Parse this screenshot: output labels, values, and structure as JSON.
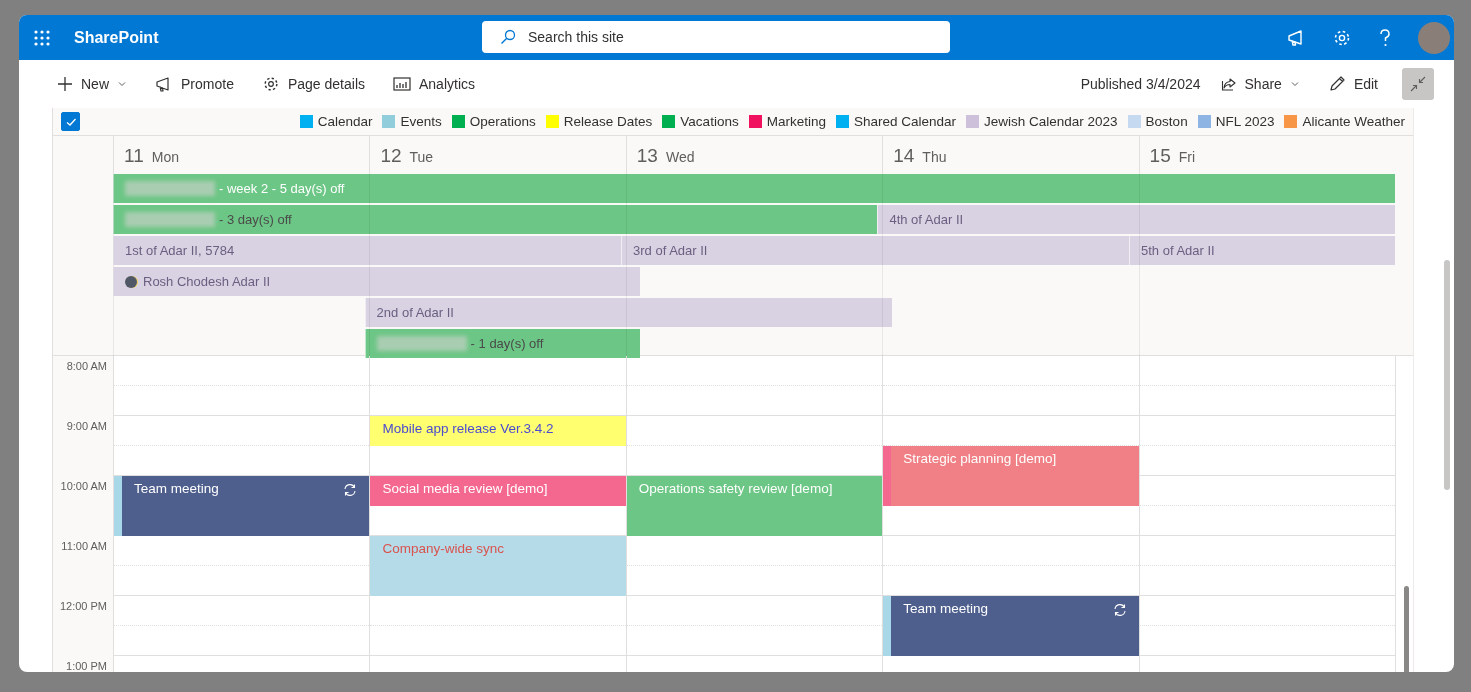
{
  "app_bar": {
    "title": "SharePoint",
    "search": {
      "placeholder": "Search this site"
    }
  },
  "command_bar": {
    "left": [
      {
        "kind": "new",
        "label": "New"
      },
      {
        "kind": "promote",
        "label": "Promote"
      },
      {
        "kind": "details",
        "label": "Page details"
      },
      {
        "kind": "analytics",
        "label": "Analytics"
      }
    ],
    "published": "Published 3/4/2024",
    "share": "Share",
    "edit": "Edit"
  },
  "legend": {
    "all_checked": true,
    "items": [
      {
        "label": "Calendar",
        "color": "#00b0f0"
      },
      {
        "label": "Events",
        "color": "#92cddc"
      },
      {
        "label": "Operations",
        "color": "#00b050"
      },
      {
        "label": "Release Dates",
        "color": "#ffff00"
      },
      {
        "label": "Vacations",
        "color": "#00b050"
      },
      {
        "label": "Marketing",
        "color": "#f0115f"
      },
      {
        "label": "Shared Calendar",
        "color": "#00b0f0"
      },
      {
        "label": "Jewish Calendar 2023",
        "color": "#ccc0da"
      },
      {
        "label": "Boston",
        "color": "#c5d9f1"
      },
      {
        "label": "NFL 2023",
        "color": "#8db4e2"
      },
      {
        "label": "Alicante Weather",
        "color": "#f79646"
      }
    ]
  },
  "days": [
    {
      "date": "11",
      "weekday": "Mon",
      "slots": [
        {
          "kind": "free"
        },
        {
          "kind": "free"
        },
        {
          "kind": "free"
        },
        {
          "kind": "free"
        },
        {
          "kind": "meeting",
          "title": "Team meeting",
          "recurring": true,
          "color": "#4e5f8e"
        },
        {
          "kind": "continued"
        }
      ]
    },
    {
      "date": "12",
      "weekday": "Tue",
      "slots": [
        {
          "kind": "free"
        },
        {
          "kind": "free"
        },
        {
          "kind": "release",
          "title": "Mobile app release Ver.3.4.2",
          "recurring": false,
          "color": "#ffff70"
        },
        {
          "kind": "free"
        },
        {
          "kind": "marketing",
          "title": "Social media review [demo]",
          "recurring": false,
          "color": "#f4678f"
        },
        {
          "kind": "free"
        },
        {
          "kind": "sync",
          "title": "Company-wide sync",
          "recurring": false,
          "color": "#b5dbe8"
        },
        {
          "kind": "continued"
        }
      ]
    },
    {
      "date": "13",
      "weekday": "Wed",
      "slots": [
        {
          "kind": "free"
        },
        {
          "kind": "free"
        },
        {
          "kind": "free"
        },
        {
          "kind": "free"
        },
        {
          "kind": "operations",
          "title": "Operations safety review [demo]",
          "recurring": false,
          "color": "#6cc685"
        },
        {
          "kind": "continued"
        }
      ]
    },
    {
      "date": "14",
      "weekday": "Thu",
      "slots": [
        {
          "kind": "free"
        },
        {
          "kind": "free"
        },
        {
          "kind": "free"
        },
        {
          "kind": "planning",
          "title": "Strategic planning [demo]",
          "recurring": false,
          "color": "#f08085"
        },
        {
          "kind": "continued"
        },
        {
          "kind": "free"
        },
        {
          "kind": "free"
        },
        {
          "kind": "free"
        },
        {
          "kind": "meeting",
          "title": "Team meeting",
          "recurring": true,
          "color": "#4e5f8e"
        },
        {
          "kind": "continued"
        }
      ]
    },
    {
      "date": "15",
      "weekday": "Fri"
    }
  ],
  "all_day_lanes": [
    [
      {
        "kind": "vacation-light",
        "text": "- week 2 - 5 day(s) off",
        "name_hidden": true,
        "color": "#6cc685"
      },
      {
        "kind": "continued"
      },
      {
        "kind": "continued"
      },
      {
        "kind": "continued"
      },
      {
        "kind": "continued"
      }
    ],
    [
      {
        "kind": "vacation",
        "text": "- 3 day(s) off",
        "name_hidden": true,
        "color": "#6cc685"
      },
      {
        "kind": "continued"
      },
      {
        "kind": "continued"
      },
      {
        "kind": "holiday",
        "text": "4th of Adar II",
        "name_hidden": false,
        "color": "#d9d2e2"
      },
      {
        "kind": "continued"
      }
    ],
    [
      {
        "kind": "holiday",
        "text": "1st of Adar II, 5784",
        "name_hidden": false,
        "color": "#d9d2e2"
      },
      {
        "kind": "continued"
      },
      {
        "kind": "holiday",
        "text": "3rd of Adar II",
        "name_hidden": false,
        "color": "#d9d2e2"
      },
      {
        "kind": "continued"
      },
      {
        "kind": "holiday",
        "text": "5th of Adar II",
        "name_hidden": false,
        "color": "#d9d2e2"
      }
    ],
    [
      {
        "kind": "holiday",
        "text": "Rosh Chodesh Adar II",
        "name_hidden": false,
        "moon": true,
        "color": "#d9d2e2"
      },
      {
        "kind": "continued"
      }
    ],
    [
      {
        "kind": "free"
      },
      {
        "kind": "holiday",
        "text": "2nd of Adar II",
        "name_hidden": false,
        "color": "#d9d2e2"
      },
      {
        "kind": "continued"
      }
    ],
    [
      {
        "kind": "free"
      },
      {
        "kind": "vacation",
        "text": "- 1 day(s) off",
        "name_hidden": true,
        "color": "#6cc685"
      }
    ]
  ],
  "hours": [
    "8:00 AM",
    "9:00 AM",
    "10:00 AM",
    "11:00 AM",
    "12:00 PM",
    "1:00 PM"
  ]
}
